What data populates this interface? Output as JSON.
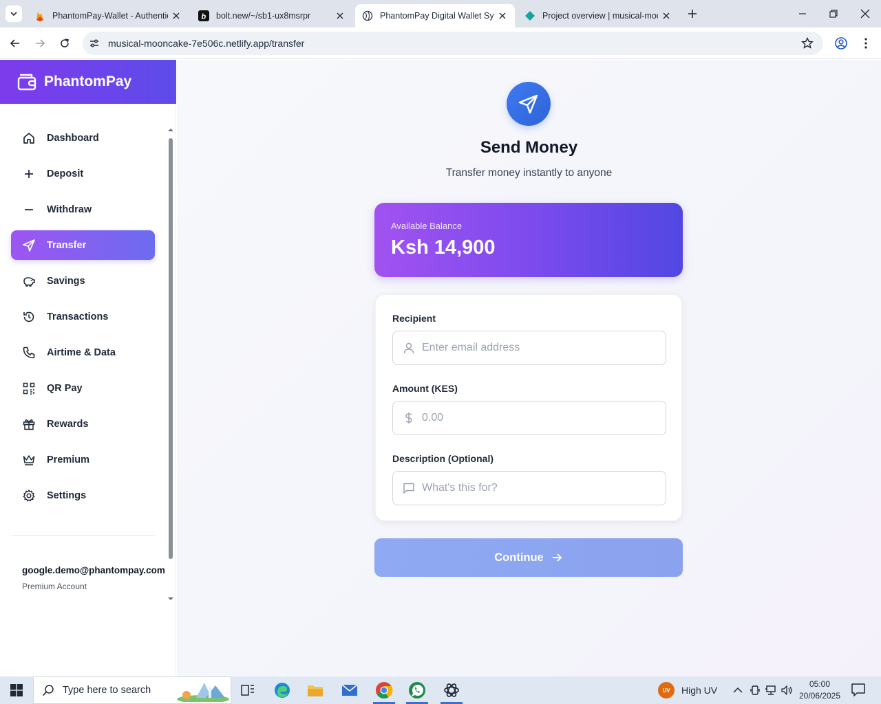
{
  "browser": {
    "tabs": [
      {
        "title": "PhantomPay-Wallet - Authentic",
        "active": false
      },
      {
        "title": "bolt.new/~/sb1-ux8msrpr",
        "active": false
      },
      {
        "title": "PhantomPay Digital Wallet Syst",
        "active": true
      },
      {
        "title": "Project overview | musical-moo",
        "active": false
      }
    ],
    "url": "musical-mooncake-7e506c.netlify.app/transfer"
  },
  "sidebar": {
    "brand": "PhantomPay",
    "items": [
      {
        "label": "Dashboard",
        "icon": "home-icon"
      },
      {
        "label": "Deposit",
        "icon": "plus-icon"
      },
      {
        "label": "Withdraw",
        "icon": "minus-icon"
      },
      {
        "label": "Transfer",
        "icon": "send-icon",
        "active": true
      },
      {
        "label": "Savings",
        "icon": "piggy-bank-icon"
      },
      {
        "label": "Transactions",
        "icon": "history-icon"
      },
      {
        "label": "Airtime & Data",
        "icon": "phone-icon"
      },
      {
        "label": "QR Pay",
        "icon": "qr-code-icon"
      },
      {
        "label": "Rewards",
        "icon": "gift-icon"
      },
      {
        "label": "Premium",
        "icon": "crown-icon"
      },
      {
        "label": "Settings",
        "icon": "gear-icon"
      }
    ],
    "user": {
      "email": "google.demo@phantompay.com",
      "plan": "Premium Account"
    }
  },
  "main": {
    "title": "Send Money",
    "subtitle": "Transfer money instantly to anyone",
    "balance": {
      "label": "Available Balance",
      "amount": "Ksh 14,900"
    },
    "form": {
      "recipient": {
        "label": "Recipient",
        "placeholder": "Enter email address",
        "value": ""
      },
      "amount": {
        "label": "Amount (KES)",
        "placeholder": "0.00",
        "value": ""
      },
      "description": {
        "label": "Description (Optional)",
        "placeholder": "What's this for?",
        "value": ""
      }
    },
    "continue_label": "Continue"
  },
  "taskbar": {
    "search_placeholder": "Type here to search",
    "weather_badge": "UV",
    "weather": "High UV",
    "time": "05:00",
    "date": "20/06/2025"
  },
  "colors": {
    "brand_gradient_start": "#7e3bec",
    "brand_gradient_end": "#5d4bea",
    "accent_blue": "#3f7af0",
    "continue_disabled": "#8faaf3"
  }
}
